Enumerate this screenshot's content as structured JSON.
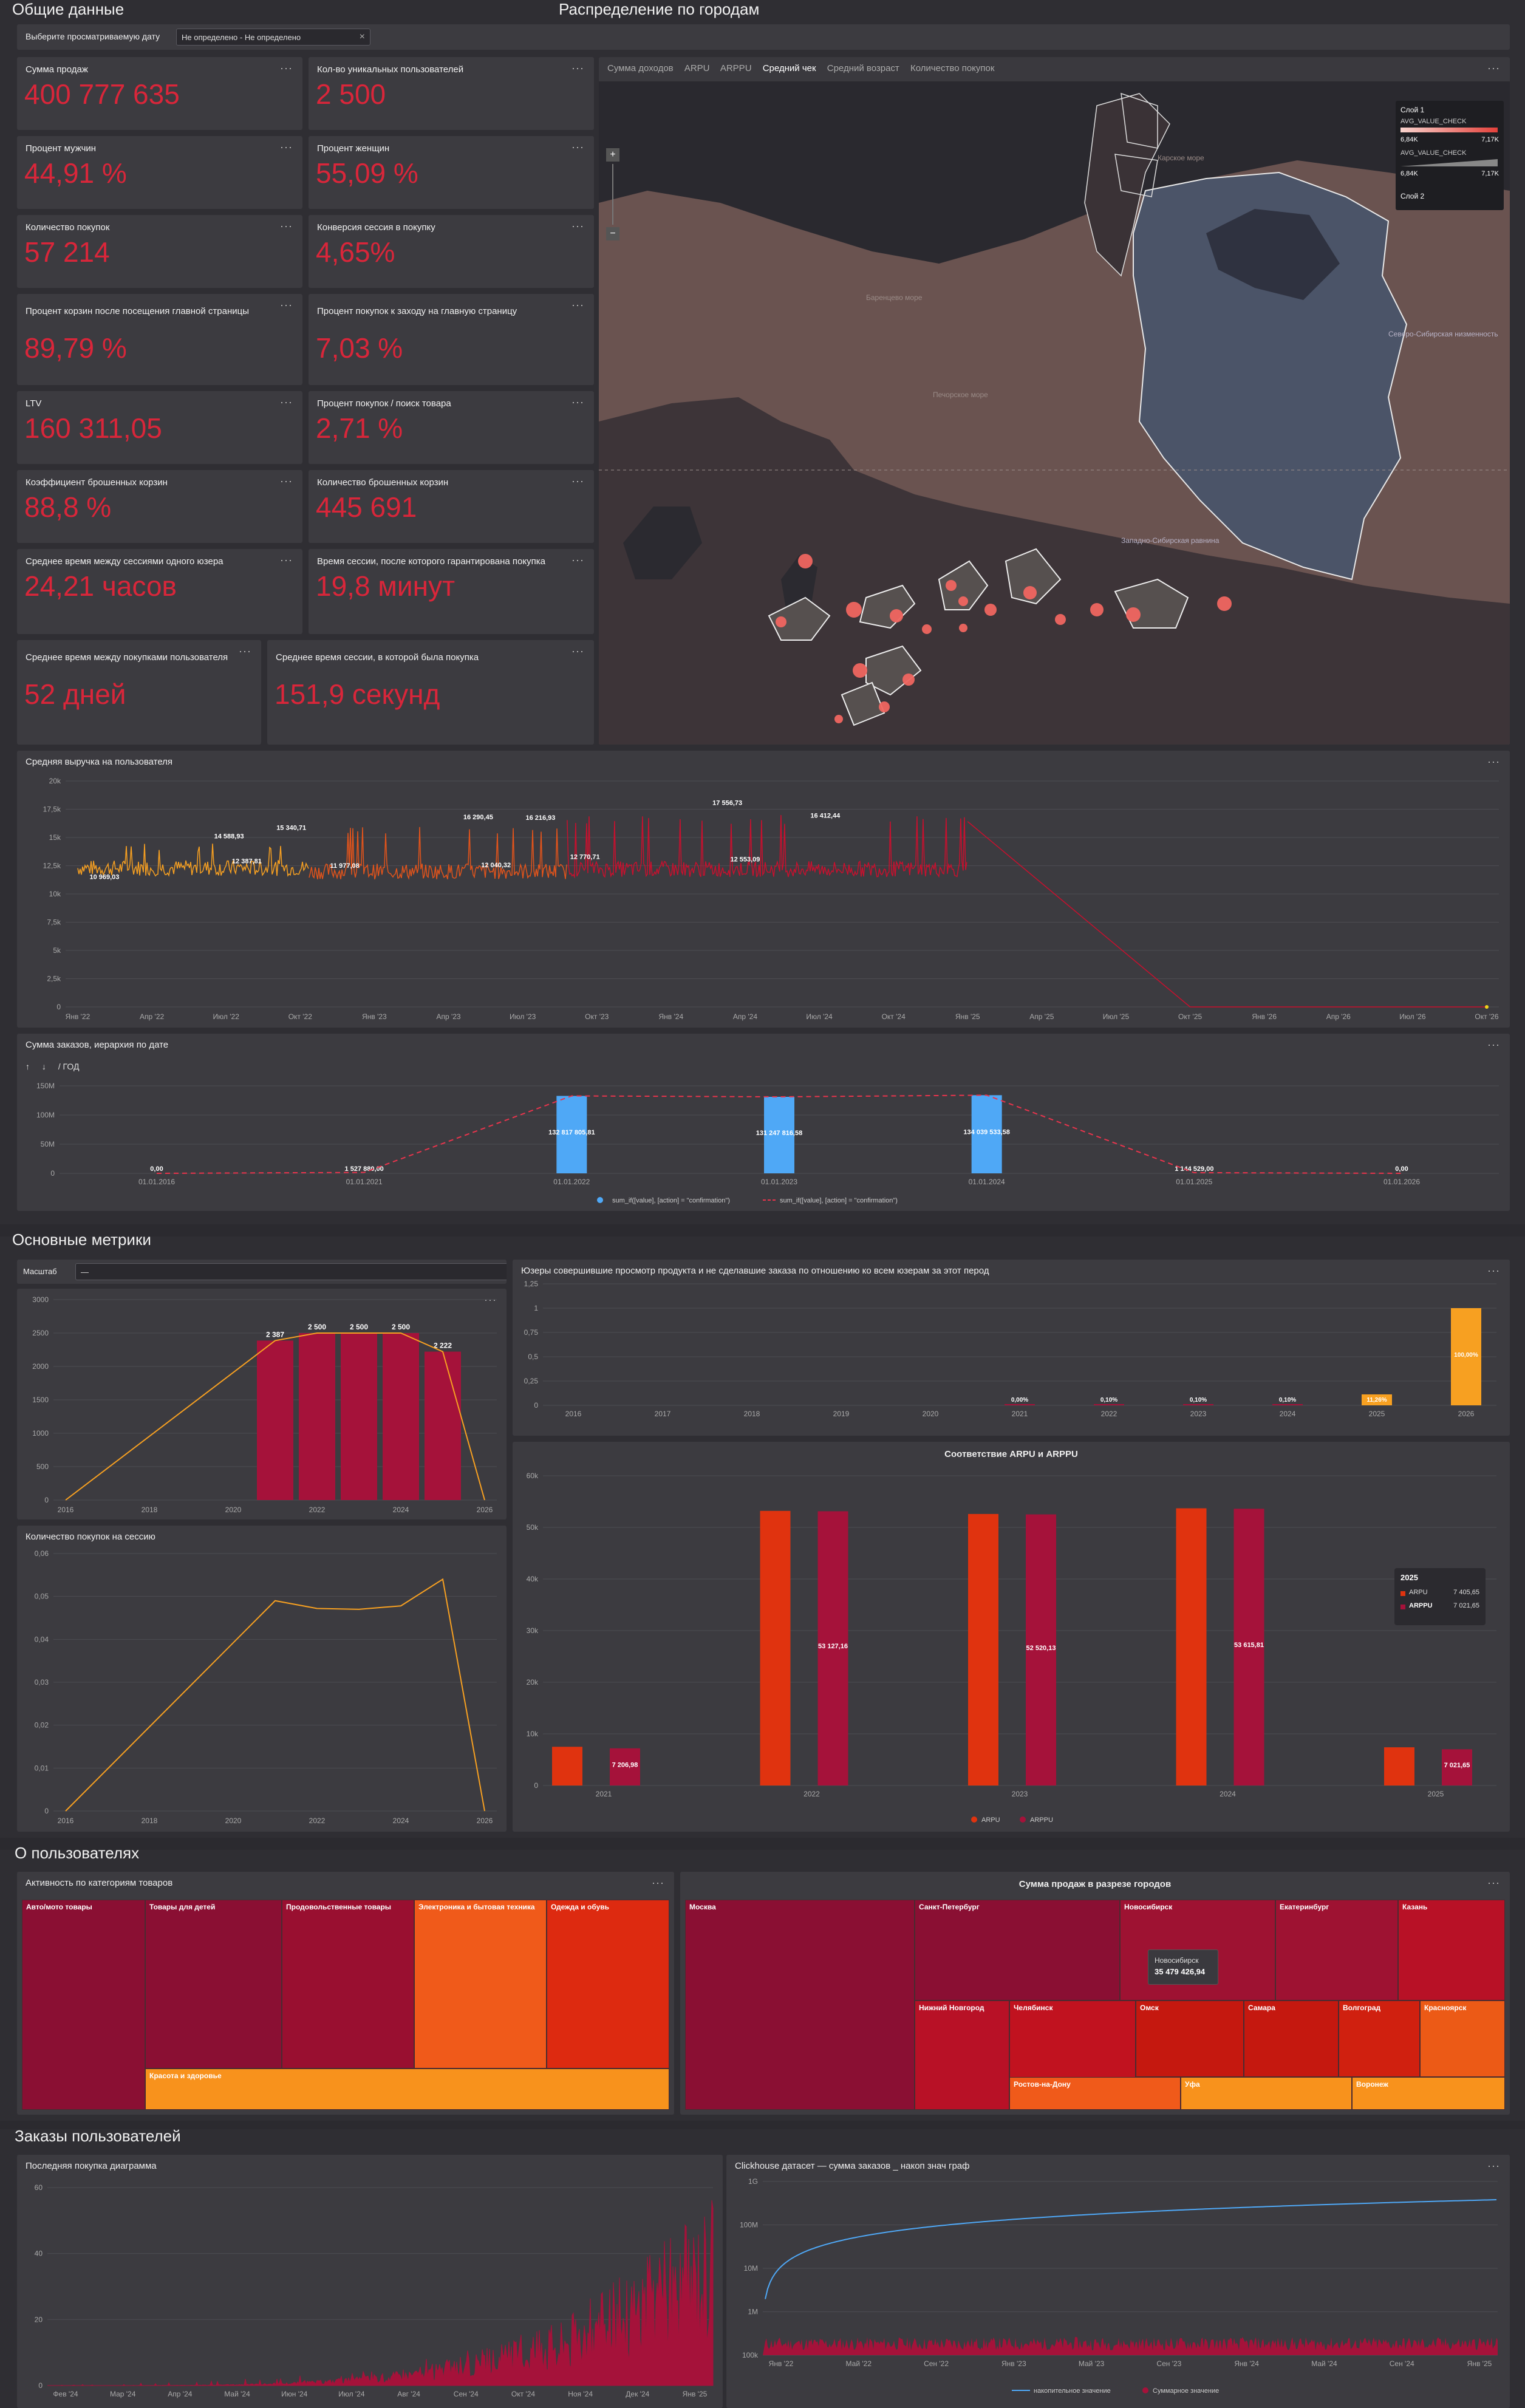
{
  "sections": {
    "general": "Общие данные",
    "cities": "Распределение по городам",
    "metrics": "Основные метрики",
    "users": "О пользователях",
    "orders": "Заказы пользователей"
  },
  "date_filter": {
    "label": "Выберите просматриваемую дату",
    "value": "Не определено - Не определено",
    "clear": "×"
  },
  "menu_dots": "···",
  "kpis": [
    {
      "label": "Сумма продаж",
      "value": "400 777 635"
    },
    {
      "label": "Кол-во уникальных пользователей",
      "value": "2 500"
    },
    {
      "label": "Процент мужчин",
      "value": "44,91 %"
    },
    {
      "label": "Процент женщин",
      "value": "55,09 %"
    },
    {
      "label": "Количество покупок",
      "value": "57 214"
    },
    {
      "label": "Конверсия сессия в покупку",
      "value": "4,65%"
    },
    {
      "label": "Процент корзин после посещения главной страницы",
      "value": "89,79 %"
    },
    {
      "label": "Процент покупок к заходу на главную страницу",
      "value": "7,03 %"
    },
    {
      "label": "LTV",
      "value": "160 311,05"
    },
    {
      "label": "Процент покупок / поиск товара",
      "value": "2,71 %"
    },
    {
      "label": "Коэффициент брошенных корзин",
      "value": "88,8 %"
    },
    {
      "label": "Количество брошенных корзин",
      "value": "445 691"
    },
    {
      "label": "Среднее время между сессиями одного юзера",
      "value": "24,21 часов"
    },
    {
      "label": "Время сессии, после которого гарантирована покупка",
      "value": "19,8 минут"
    },
    {
      "label": "Среднее время между покупками пользователя",
      "value": "52 дней"
    },
    {
      "label": "Среднее время сессии, в которой была покупка",
      "value": "151,9 секунд"
    }
  ],
  "map": {
    "tabs": [
      "Сумма доходов",
      "ARPU",
      "ARPPU",
      "Средний чек",
      "Средний возраст",
      "Количество покупок"
    ],
    "active_tab": 3,
    "zoom_in": "+",
    "zoom_out": "−",
    "legend": {
      "layer1": "Слой 1",
      "metric": "AVG_VALUE_CHECK",
      "min": "6,84K",
      "max": "7,17K",
      "layer2": "Слой 2"
    },
    "places": [
      "Карское море",
      "Баренцево море",
      "Печорское море",
      "Северо-Сибирская низменность",
      "Западно-Сибирская равнина"
    ]
  },
  "avg_revenue": {
    "title": "Средняя выручка на пользователя",
    "y_ticks": [
      "20k",
      "17,5k",
      "15k",
      "12,5k",
      "10k",
      "7,5k",
      "5k",
      "2,5k",
      "0"
    ],
    "x_ticks": [
      "Янв '22",
      "Апр '22",
      "Июл '22",
      "Окт '22",
      "Янв '23",
      "Апр '23",
      "Июл '23",
      "Окт '23",
      "Янв '24",
      "Апр '24",
      "Июл '24",
      "Окт '24",
      "Янв '25",
      "Апр '25",
      "Июл '25",
      "Окт '25",
      "Янв '26",
      "Апр '26",
      "Июл '26",
      "Окт '26"
    ],
    "labels": [
      "10 969,03",
      "14 588,93",
      "12 387,81",
      "15 340,71",
      "11 977,08",
      "16 290,45",
      "12 040,32",
      "16 216,93",
      "12 770,71",
      "17 556,73",
      "12 553,09",
      "16 412,44"
    ],
    "colors": [
      "#f7a021",
      "#e3541b",
      "#c8102e"
    ]
  },
  "orders_hierarchy": {
    "title": "Сумма заказов, иерархия по дате",
    "drill_up": "↑",
    "drill_down": "↓",
    "level": "/ ГОД",
    "y_ticks": [
      "150M",
      "100M",
      "50M",
      "0"
    ],
    "x_ticks": [
      "01.01.2016",
      "01.01.2021",
      "01.01.2022",
      "01.01.2023",
      "01.01.2024",
      "01.01.2025",
      "01.01.2026"
    ],
    "bar_values": [
      "0,00",
      "1 527 880,00",
      "132 817 805,81",
      "131 247 816,58",
      "134 039 533,58",
      "1 144 529,00",
      "0,00"
    ],
    "chart_data": {
      "type": "bar",
      "categories": [
        "01.01.2016",
        "01.01.2021",
        "01.01.2022",
        "01.01.2023",
        "01.01.2024",
        "01.01.2025",
        "01.01.2026"
      ],
      "values": [
        0,
        1527880,
        132817805.81,
        131247816.58,
        134039533.58,
        1144529,
        0
      ],
      "ylim": [
        0,
        150000000
      ]
    },
    "legend": [
      "sum_if([value], [action] = \"confirmation\")",
      "sum_if([value], [action] = \"confirmation\")"
    ]
  },
  "scale_select": {
    "label": "Масштаб",
    "value": "—"
  },
  "users_year": {
    "y_ticks": [
      "3000",
      "2500",
      "2000",
      "1500",
      "1000",
      "500",
      "0"
    ],
    "x_ticks": [
      "2016",
      "2018",
      "2020",
      "2022",
      "2024",
      "2026"
    ],
    "labels": [
      "2 387",
      "2 500",
      "2 500",
      "2 500",
      "2 222"
    ]
  },
  "purchases_per_session": {
    "title": "Количество покупок на сессию",
    "y_ticks": [
      "0,06",
      "0,05",
      "0,04",
      "0,03",
      "0,02",
      "0,01",
      "0"
    ],
    "x_ticks": [
      "2016",
      "2018",
      "2020",
      "2022",
      "2024",
      "2026"
    ]
  },
  "viewers_no_order": {
    "title": "Юзеры совершившие просмотр продукта и не сделавшие заказа по отношению ко всем юзерам за этот перод",
    "y_ticks": [
      "1,25",
      "1",
      "0,75",
      "0,5",
      "0,25",
      "0"
    ],
    "x_ticks": [
      "2016",
      "2017",
      "2018",
      "2019",
      "2020",
      "2021",
      "2022",
      "2023",
      "2024",
      "2025",
      "2026"
    ],
    "labels": [
      "0,00%",
      "0,10%",
      "0,10%",
      "0,10%",
      "11,26%",
      "100,00%"
    ]
  },
  "arpu_arppu": {
    "title": "Соответствие ARPU и ARPPU",
    "y_ticks": [
      "60k",
      "50k",
      "40k",
      "30k",
      "20k",
      "10k",
      "0"
    ],
    "x_ticks": [
      "2021",
      "2022",
      "2023",
      "2024",
      "2025"
    ],
    "labels": [
      "7 206,98",
      "53 127,16",
      "52 520,13",
      "53 615,81",
      "7 021,65"
    ],
    "tooltip": {
      "year": "2025",
      "arpu_label": "ARPU",
      "arpu_value": "7 405,65",
      "arppu_label": "ARPPU",
      "arppu_value": "7 021,65"
    },
    "legend": [
      "ARPU",
      "ARPPU"
    ]
  },
  "categories": {
    "title": "Активность по категориям товаров",
    "cells": [
      "Авто/мото товары",
      "Товары для детей",
      "Продовольственные товары",
      "Электроника и бытовая техника",
      "Одежда и обувь",
      "Красота и здоровье"
    ]
  },
  "cities_sales": {
    "title": "Сумма продаж в разрезе городов",
    "cells": [
      "Москва",
      "Санкт-Петербург",
      "Новосибирск",
      "Екатеринбург",
      "Казань",
      "Нижний Новгород",
      "Челябинск",
      "Омск",
      "Самара",
      "Волгоград",
      "Красноярск",
      "Ростов-на-Дону",
      "Уфа",
      "Воронеж"
    ],
    "tooltip": {
      "city": "Новосибирск",
      "value": "35 479 426,94"
    }
  },
  "last_purchase": {
    "title": "Последняя покупка диаграмма",
    "y_ticks": [
      "60",
      "40",
      "20",
      "0"
    ],
    "x_ticks": [
      "Фев '24",
      "Мар '24",
      "Апр '24",
      "Май '24",
      "Июн '24",
      "Июл '24",
      "Авг '24",
      "Сен '24",
      "Окт '24",
      "Ноя '24",
      "Дек '24",
      "Янв '25"
    ]
  },
  "clickhouse": {
    "title": "Clickhouse датасет — сумма заказов _ накоп знач граф",
    "y_ticks": [
      "1G",
      "100M",
      "10M",
      "1M",
      "100k"
    ],
    "x_ticks": [
      "Янв '22",
      "Май '22",
      "Сен '22",
      "Янв '23",
      "Май '23",
      "Сен '23",
      "Янв '24",
      "Май '24",
      "Сен '24",
      "Янв '25"
    ],
    "legend": [
      "накопительное значение",
      "Суммарное значение"
    ]
  }
}
